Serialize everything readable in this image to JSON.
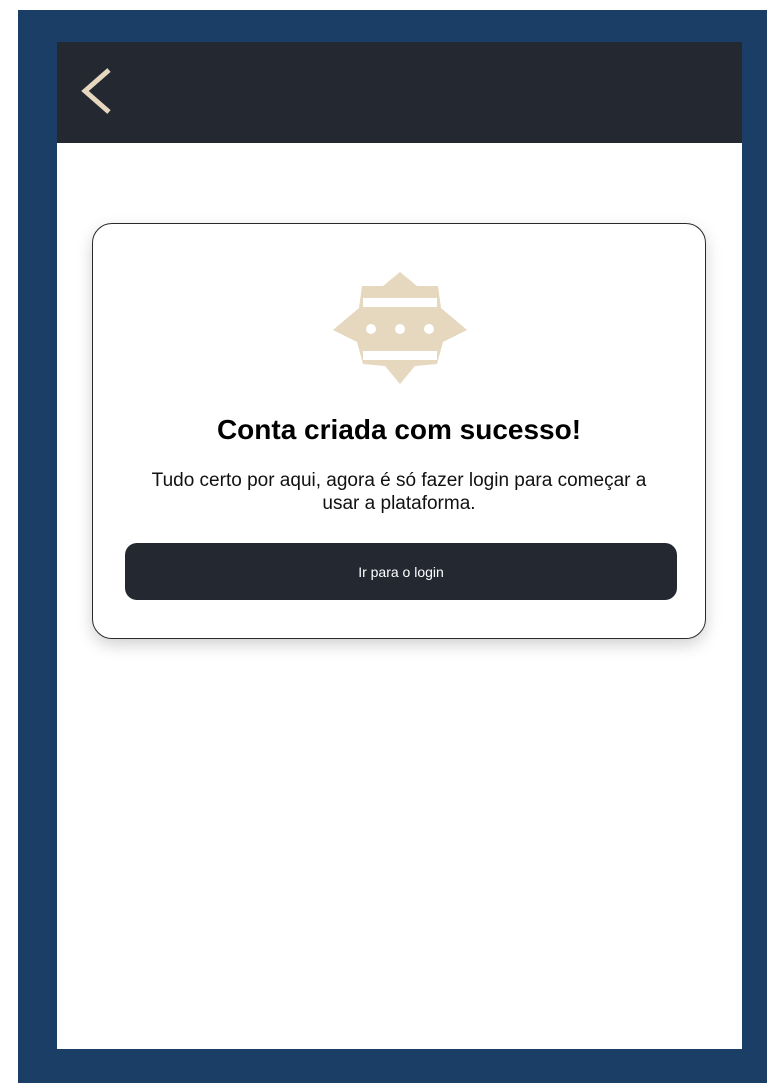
{
  "topbar": {
    "back_icon": "chevron-left-icon",
    "background": "#232831",
    "icon_color": "#e6d7bf"
  },
  "card": {
    "icon": "badge-icon",
    "icon_color": "#e6d7bf",
    "title": "Conta criada com sucesso!",
    "message": "Tudo certo por aqui, agora é só fazer login para começar a usar a plataforma.",
    "button_label": "Ir para o login",
    "button_color": "#232831"
  },
  "frame_color": "#1a3e66"
}
